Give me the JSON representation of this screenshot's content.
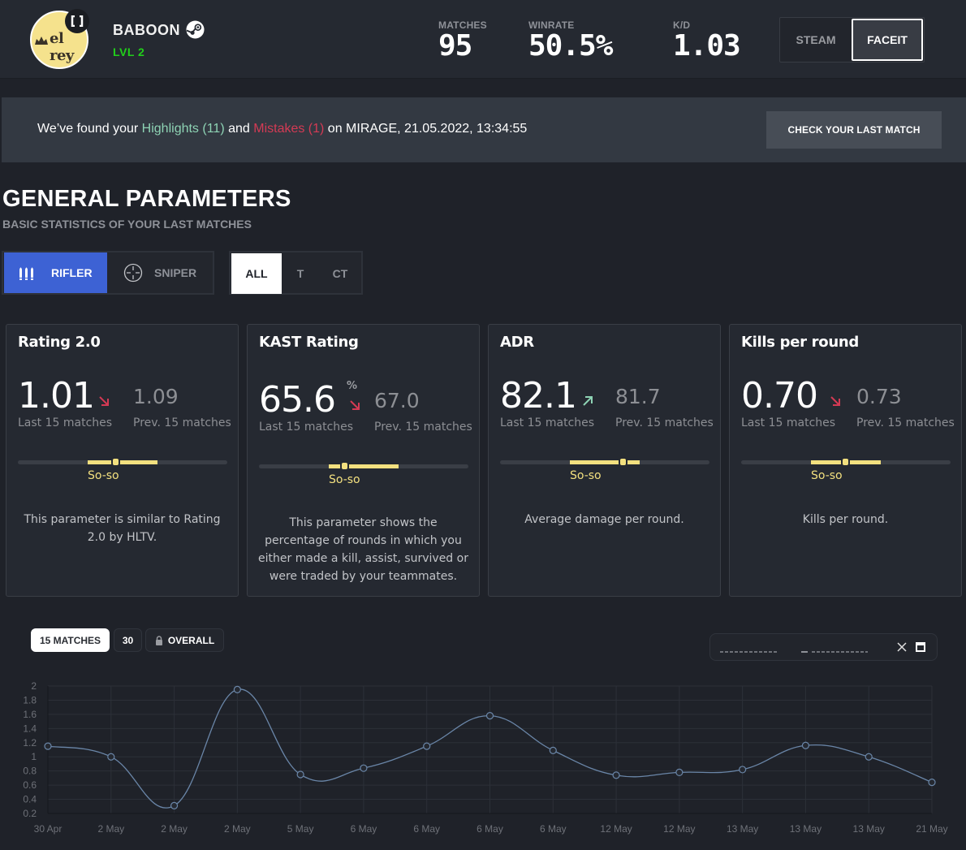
{
  "header": {
    "avatar_text": "el rey",
    "player_name": "BABOON",
    "level": "LVL 2",
    "stats": [
      {
        "label": "MATCHES",
        "value": "95"
      },
      {
        "label": "WINRATE",
        "value": "50.5%"
      },
      {
        "label": "K/D",
        "value": "1.03"
      }
    ],
    "source_tabs": [
      {
        "label": "STEAM",
        "active": false
      },
      {
        "label": "FACEIT",
        "active": true
      }
    ]
  },
  "banner": {
    "prefix": "We’ve found your ",
    "highlights": "Highlights (11)",
    "middle": " and ",
    "mistakes": "Mistakes (1)",
    "suffix": " on MIRAGE, 21.05.2022, 13:34:55",
    "button_label": "CHECK YOUR LAST MATCH",
    "highlight_color": "#8ed3b4",
    "mistake_color": "#d43a54"
  },
  "section": {
    "title": "GENERAL PARAMETERS",
    "subtitle": "BASIC STATISTICS OF YOUR LAST MATCHES",
    "roles": [
      {
        "label": "RIFLER",
        "icon": "bullets-icon",
        "active": true
      },
      {
        "label": "SNIPER",
        "icon": "crosshair-icon",
        "active": false
      }
    ],
    "sides": [
      {
        "label": "ALL",
        "active": true
      },
      {
        "label": "T",
        "active": false
      },
      {
        "label": "CT",
        "active": false
      }
    ]
  },
  "cards": [
    {
      "title": "Rating 2.0",
      "value": "1.01",
      "unit": "",
      "trend": "down",
      "prev_value": "1.09",
      "last_label": "Last 15 matches",
      "prev_label": "Prev. 15 matches",
      "grade": "So-so",
      "grade_position_pct": 47,
      "description": "This parameter is similar to Rating 2.0 by HLTV."
    },
    {
      "title": "KAST Rating",
      "value": "65.6",
      "unit": "%",
      "trend": "down",
      "prev_value": "67.0",
      "last_label": "Last 15 matches",
      "prev_label": "Prev. 15 matches",
      "grade": "So-so",
      "grade_position_pct": 41,
      "description": "This parameter shows the percentage of rounds in which you either made a kill, assist, survived or were traded by your teammates."
    },
    {
      "title": "ADR",
      "value": "82.1",
      "unit": "",
      "trend": "up",
      "prev_value": "81.7",
      "last_label": "Last 15 matches",
      "prev_label": "Prev. 15 matches",
      "grade": "So-so",
      "grade_position_pct": 59,
      "description": "Average damage per round."
    },
    {
      "title": "Kills per round",
      "value": "0.70",
      "unit": "",
      "trend": "down",
      "prev_value": "0.73",
      "last_label": "Last 15 matches",
      "prev_label": "Prev. 15 matches",
      "grade": "So-so",
      "grade_position_pct": 50,
      "description": "Kills per round."
    }
  ],
  "chart_controls": {
    "ranges": [
      {
        "label": "15 MATCHES",
        "active": true
      },
      {
        "label": "30",
        "active": false
      },
      {
        "label": "OVERALL",
        "active": false,
        "locked": true
      }
    ]
  },
  "colors": {
    "accent_blue": "#3d62d4",
    "grade_yellow": "#f3e07f",
    "trend_up": "#8ed3b4",
    "trend_down": "#d43a54",
    "line": "#6a86a8"
  },
  "chart_data": {
    "type": "line",
    "title": "",
    "xlabel": "",
    "ylabel": "",
    "categories": [
      "30 Apr",
      "2 May",
      "2 May",
      "2 May",
      "5 May",
      "6 May",
      "6 May",
      "6 May",
      "6 May",
      "12 May",
      "12 May",
      "13 May",
      "13 May",
      "13 May",
      "21 May"
    ],
    "series": [
      {
        "name": "Rating 2.0",
        "values": [
          1.15,
          1.0,
          0.31,
          1.95,
          0.75,
          0.84,
          1.15,
          1.58,
          1.09,
          0.74,
          0.78,
          0.82,
          1.16,
          1.0,
          0.64
        ]
      }
    ],
    "yticks": [
      "2",
      "1.8",
      "1.6",
      "1.4",
      "1.2",
      "1",
      "0.8",
      "0.6",
      "0.4",
      "0.2"
    ],
    "ylim": [
      0.2,
      2.0
    ],
    "grid": true,
    "legend": "none"
  }
}
